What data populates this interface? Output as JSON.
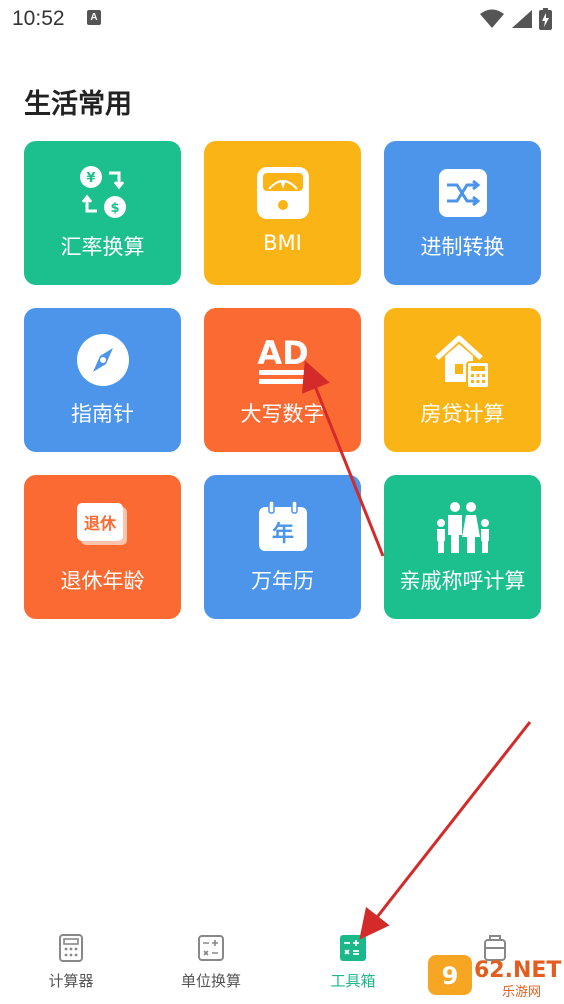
{
  "status_bar": {
    "time": "10:52",
    "notification_letter": "A",
    "icons": [
      "wifi-icon",
      "signal-icon",
      "battery-charging-icon"
    ]
  },
  "section": {
    "title": "生活常用"
  },
  "tools": [
    {
      "label": "汇率换算",
      "icon": "currency-exchange-icon",
      "color": "#1cc08f"
    },
    {
      "label": "BMI",
      "icon": "bmi-scale-icon",
      "color": "#fbb416"
    },
    {
      "label": "进制转换",
      "icon": "base-conversion-icon",
      "color": "#4d95ea"
    },
    {
      "label": "指南针",
      "icon": "compass-icon",
      "color": "#4d95ea"
    },
    {
      "label": "大写数字",
      "icon": "uppercase-number-icon",
      "color": "#fb6a32"
    },
    {
      "label": "房贷计算",
      "icon": "mortgage-icon",
      "color": "#fbb416"
    },
    {
      "label": "退休年龄",
      "icon": "retirement-icon",
      "icon_text": "退休",
      "color": "#fb6a32"
    },
    {
      "label": "万年历",
      "icon": "calendar-icon",
      "icon_text": "年",
      "color": "#4d95ea"
    },
    {
      "label": "亲戚称呼计算",
      "icon": "family-icon",
      "color": "#1cc08f"
    }
  ],
  "bmi_icon_text": "AD",
  "tabs": [
    {
      "label": "计算器",
      "icon": "calculator-icon",
      "active": false
    },
    {
      "label": "单位换算",
      "icon": "unit-convert-icon",
      "active": false
    },
    {
      "label": "工具箱",
      "icon": "toolbox-icon",
      "active": true
    },
    {
      "label": "",
      "icon": "tab-4-icon",
      "active": false
    }
  ],
  "watermark": {
    "text": "962.NET",
    "subtext": "乐游网"
  },
  "colors": {
    "accent_green": "#1bb889",
    "annotation_red": "#d42a2a"
  }
}
